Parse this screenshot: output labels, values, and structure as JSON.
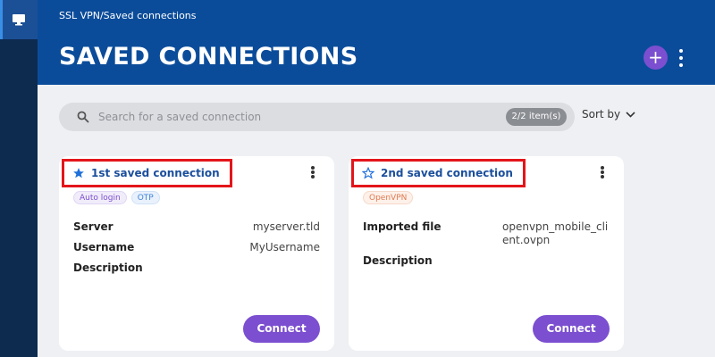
{
  "nav": {
    "items": [
      {
        "icon": "monitor-icon",
        "active": true
      }
    ]
  },
  "header": {
    "breadcrumb": "SSL VPN/Saved connections",
    "title": "SAVED CONNECTIONS",
    "add_label": "+"
  },
  "search": {
    "placeholder": "Search for a saved connection",
    "value": "",
    "count": "2/2 item(s)"
  },
  "sort": {
    "label": "Sort by"
  },
  "colors": {
    "header": "#0b4c9a",
    "rail": "#0d2a4f",
    "accent": "#7b4fd0",
    "highlight": "#e3151a",
    "title": "#1b4f9c"
  },
  "cards": [
    {
      "title": "1st saved connection",
      "favorite": true,
      "tags": [
        "Auto login",
        "OTP"
      ],
      "fields": [
        {
          "label": "Server",
          "value": "myserver.tld"
        },
        {
          "label": "Username",
          "value": "MyUsername"
        },
        {
          "label": "Description",
          "value": ""
        }
      ],
      "connect_label": "Connect"
    },
    {
      "title": "2nd saved connection",
      "favorite": false,
      "tags": [
        "OpenVPN"
      ],
      "fields": [
        {
          "label": "Imported file",
          "value": "openvpn_mobile_client.ovpn",
          "value_lines": [
            "openvpn_mobile_cli",
            "ent.ovpn"
          ]
        },
        {
          "label": "Description",
          "value": ""
        }
      ],
      "connect_label": "Connect"
    }
  ]
}
